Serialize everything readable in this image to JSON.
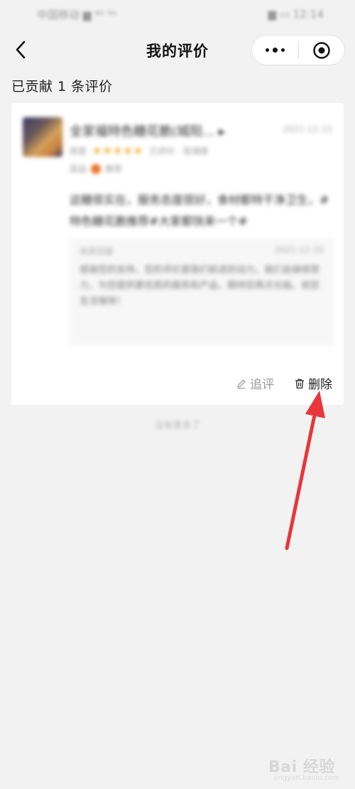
{
  "status_bar": {
    "carrier": "中国移动 ▆ ⁴ᴳ ⁵ᴳ",
    "right": "▆ ▭ 12:14"
  },
  "nav": {
    "title": "我的评价"
  },
  "summary": "已贡献 1 条评价",
  "review": {
    "shop_name": "全家福特色糖花脆(城阳... ▸",
    "date": "2021-12-15",
    "rating_label": "商家",
    "stars": "★★★★★",
    "rating_extra": "已评价 · 很满意",
    "tags_prefix": "菜品",
    "tags_suffix": "推荐",
    "text": "这糖很实在，服务态度很好，食材都特干净卫生，#特色糖花脆推荐#大家都快来一个#",
    "reply": {
      "label": "商家回复",
      "date": "2021-12-16",
      "text": "感谢您的支持，您的评价是我们前进的动力，我们会继续努力，为您提供更优质的服务和产品，期待您再次光临，祝您生活愉快！"
    }
  },
  "actions": {
    "append_label": "追评",
    "delete_label": "删除"
  },
  "footer_hint": "没有更多了",
  "watermark": {
    "brand": "Bai 经验",
    "sub": "jingyan.baidu.com"
  },
  "colors": {
    "annotation_arrow": "#e8363a",
    "star": "#f5a623"
  }
}
